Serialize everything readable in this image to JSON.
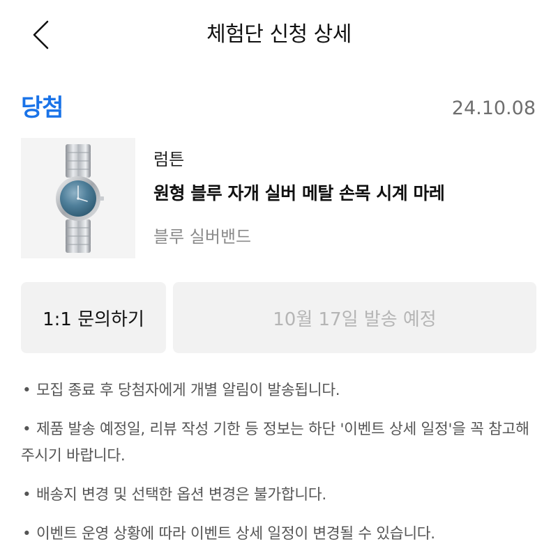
{
  "header": {
    "title": "체험단 신청 상세",
    "back_icon": "chevron-left-icon"
  },
  "status": {
    "label": "당첨",
    "color": "#1a73e8",
    "date": "24.10.08"
  },
  "product": {
    "brand": "럼튼",
    "name": "원형 블루 자개 실버 메탈 손목 시계 마레",
    "option": "블루 실버밴드",
    "image": "watch-image"
  },
  "actions": {
    "inquiry_label": "1:1 문의하기",
    "shipping_label": "10월 17일 발송 예정"
  },
  "notices": [
    "모집 종료 후 당첨자에게 개별 알림이 발송됩니다.",
    "제품 발송 예정일, 리뷰 작성 기한 등 정보는 하단 '이벤트 상세 일정'을 꼭 참고해 주시기 바랍니다.",
    "배송지 변경 및 선택한 옵션 변경은 불가합니다.",
    "이벤트 운영 상황에 따라 이벤트 상세 일정이 변경될 수 있습니다."
  ],
  "bullet_char": "•"
}
